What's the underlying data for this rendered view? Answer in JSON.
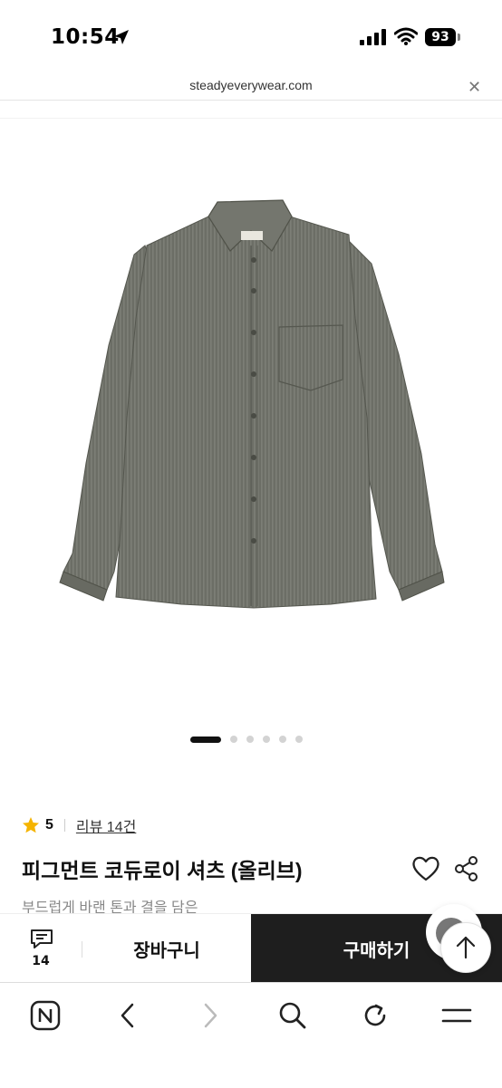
{
  "status_bar": {
    "time": "10:54",
    "battery": "93"
  },
  "url_bar": {
    "domain": "steadyeverywear.com",
    "close_icon": "close-icon"
  },
  "product": {
    "image_alt": "olive corduroy shirt",
    "carousel": {
      "total": 6,
      "active": 1
    },
    "rating": "5",
    "review_link": "리뷰 14건",
    "title": "피그먼트 코듀로이 셔츠 (올리브)",
    "subtitle": "부드럽게 바랜 톤과 결을 담은"
  },
  "action_bar": {
    "review_count": "14",
    "cart_label": "장바구니",
    "buy_label": "구매하기"
  },
  "browser_nav": [
    "naver-n-icon",
    "back-icon",
    "forward-icon",
    "search-icon",
    "reload-icon",
    "menu-icon"
  ],
  "colors": {
    "buy_bg": "#1e1e1e",
    "star": "#f5b400",
    "shirt": "#6e7068"
  }
}
